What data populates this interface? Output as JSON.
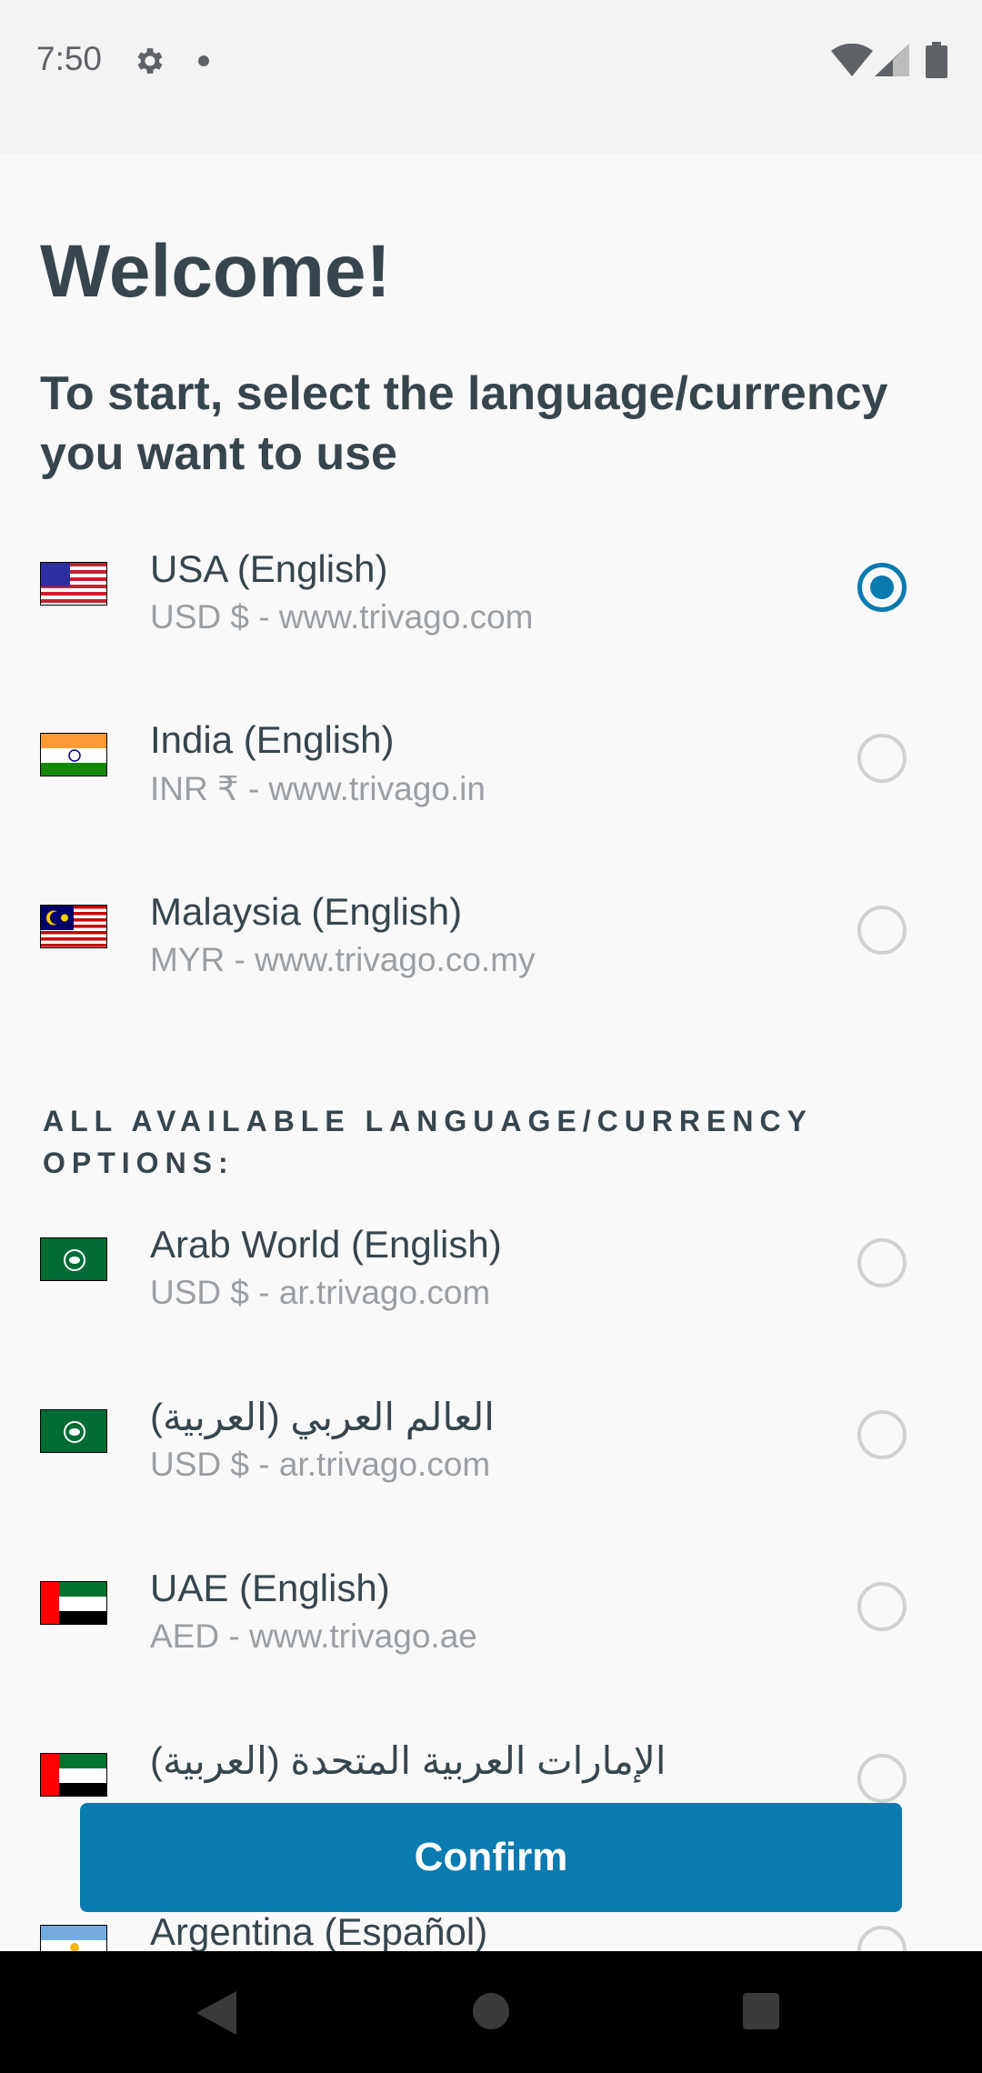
{
  "status_bar": {
    "time": "7:50",
    "icons": [
      "gear-icon",
      "notification-dot-icon",
      "wifi-icon",
      "signal-icon",
      "battery-icon"
    ]
  },
  "title": "Welcome!",
  "subtitle": "To start, select the language/currency you want to use",
  "suggested_options": [
    {
      "name": "USA (English)",
      "detail": "USD $ - www.trivago.com",
      "flag": "usa-flag-icon",
      "selected": true
    },
    {
      "name": "India (English)",
      "detail": "INR ₹ - www.trivago.in",
      "flag": "india-flag-icon",
      "selected": false
    },
    {
      "name": "Malaysia (English)",
      "detail": "MYR - www.trivago.co.my",
      "flag": "malaysia-flag-icon",
      "selected": false
    }
  ],
  "all_options_header": "ALL AVAILABLE LANGUAGE/CURRENCY OPTIONS:",
  "all_options": [
    {
      "name": "Arab World (English)",
      "detail": "USD $ - ar.trivago.com",
      "flag": "arab-world-flag-icon",
      "selected": false
    },
    {
      "name": "العالم العربي (العربية)",
      "detail": "USD $ - ar.trivago.com",
      "flag": "arab-world-flag-icon",
      "selected": false
    },
    {
      "name": "UAE (English)",
      "detail": "AED - www.trivago.ae",
      "flag": "uae-flag-icon",
      "selected": false
    },
    {
      "name": "الإمارات العربية المتحدة (العربية)",
      "detail": "",
      "flag": "uae-flag-icon",
      "selected": false
    },
    {
      "name": "Argentina (Español)",
      "detail": "",
      "flag": "argentina-flag-icon",
      "selected": false
    }
  ],
  "confirm_label": "Confirm",
  "nav_bar": {
    "icons": [
      "back-icon",
      "home-icon",
      "recents-icon"
    ]
  },
  "colors": {
    "accent": "#0a7bb0",
    "text": "#37454d",
    "subtext": "#9a9fa3"
  }
}
